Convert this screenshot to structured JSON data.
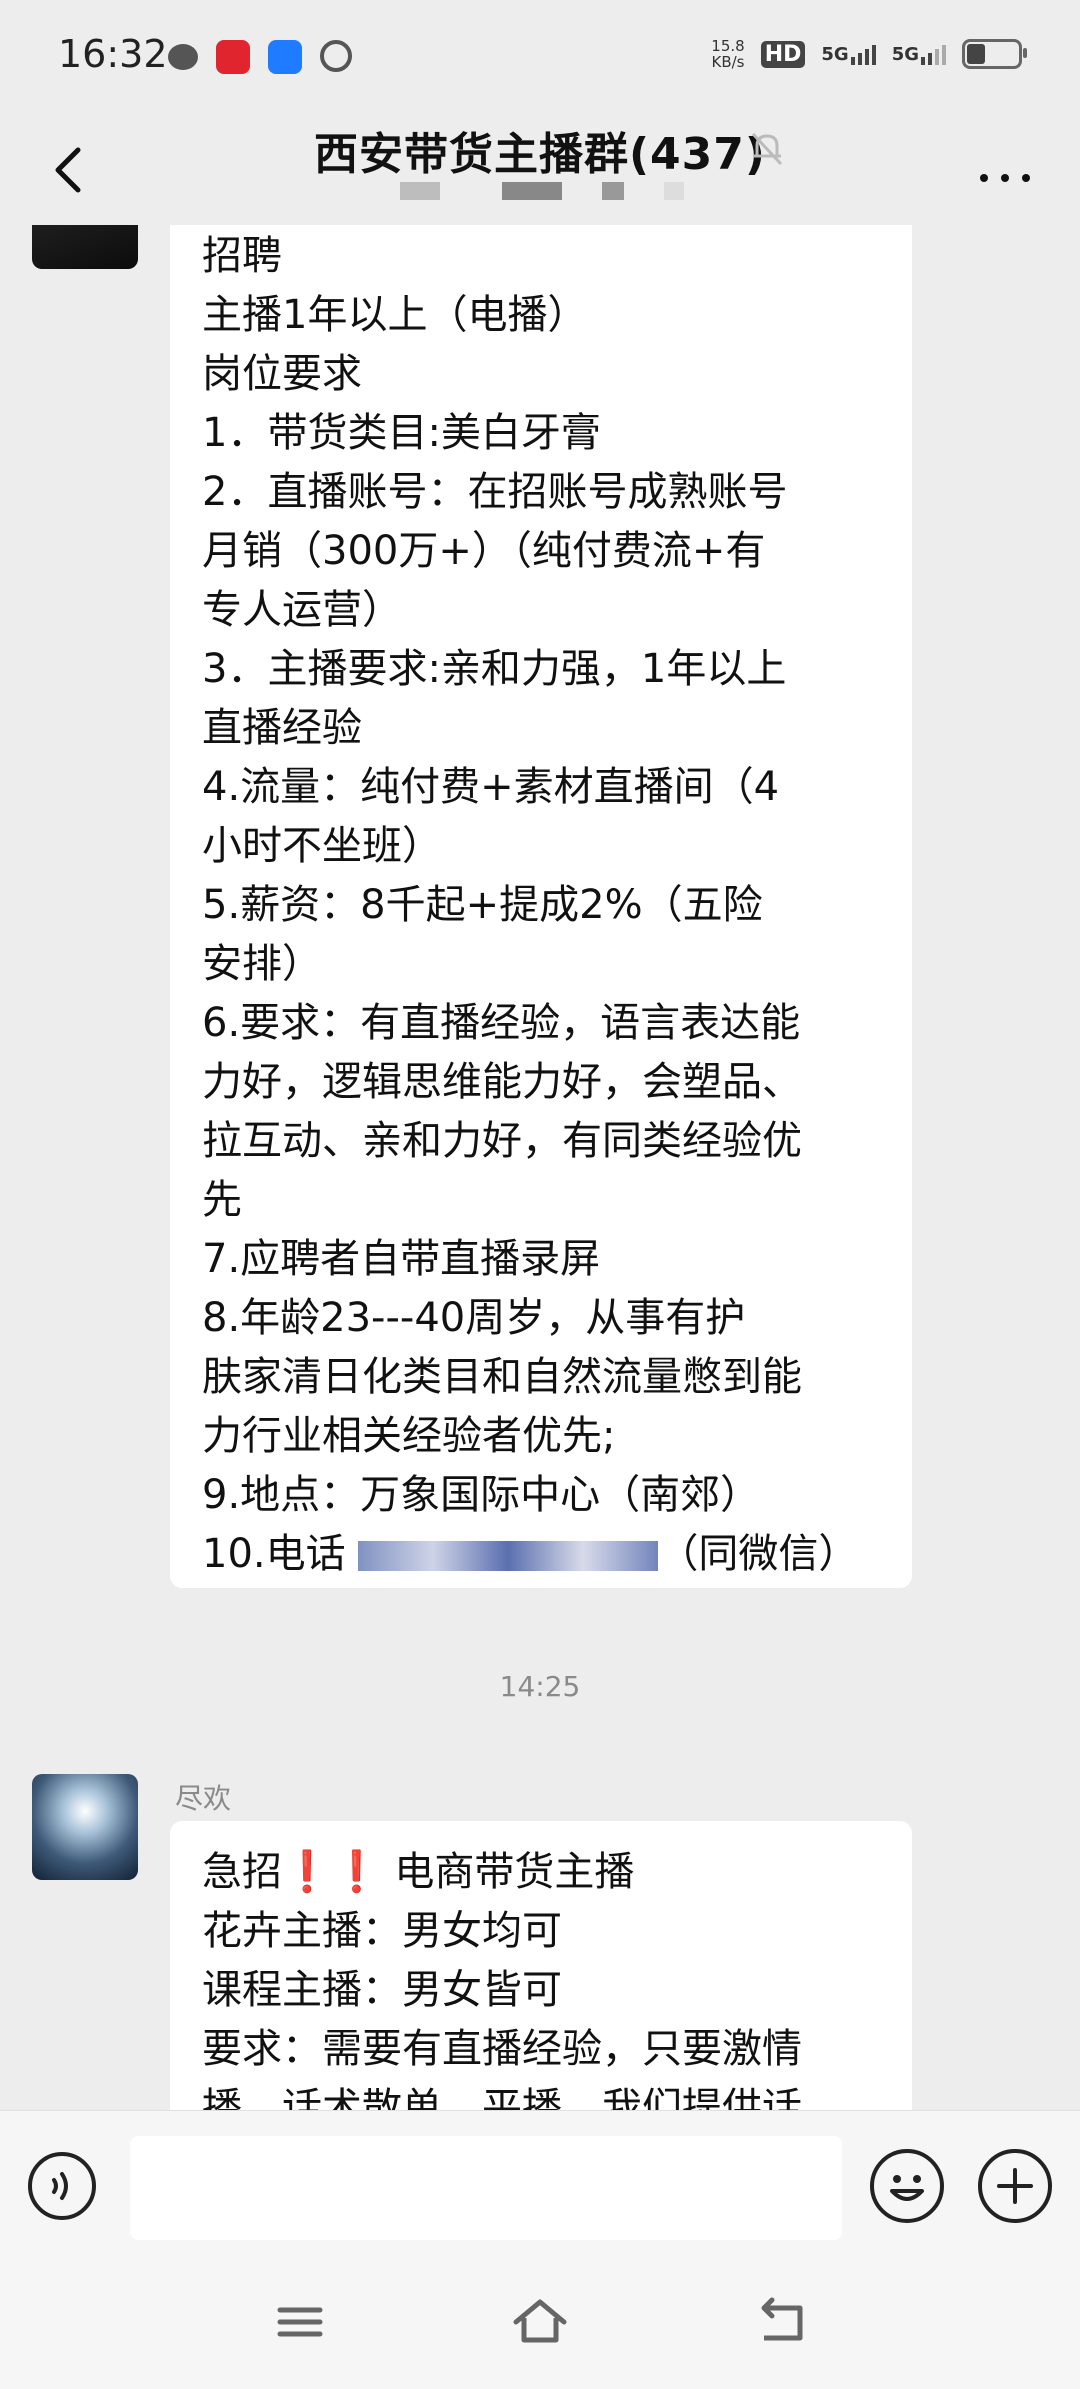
{
  "status_bar": {
    "time": "16:32",
    "net_speed_value": "15.8",
    "net_speed_unit": "KB/s",
    "hd_label": "HD",
    "signal_1": "5G",
    "signal_2": "5G"
  },
  "header": {
    "title": "西安带货主播群(437)"
  },
  "messages": [
    {
      "type": "text",
      "lines": [
        "招聘",
        "主播1年以上（电播）",
        "岗位要求",
        "1．带货类目:美白牙膏",
        "2．直播账号：在招账号成熟账号",
        "月销（300万+）（纯付费流+有",
        "专人运营）",
        "3．主播要求:亲和力强，1年以上",
        "直播经验",
        "4.流量：纯付费+素材直播间（4",
        "小时不坐班）",
        "5.薪资：8千起+提成2%（五险",
        "安排）",
        "6.要求：有直播经验，语言表达能",
        "力好，逻辑思维能力好，会塑品、",
        "拉互动、亲和力好，有同类经验优",
        "先",
        "7.应聘者自带直播录屏",
        "8.年龄23---40周岁，从事有护",
        "肤家清日化类目和自然流量憋到能",
        "力行业相关经验者优先;",
        "9.地点：万象国际中心（南郊）"
      ],
      "last_line_prefix": "10.电话",
      "last_line_suffix": "（同微信）"
    },
    {
      "type": "time",
      "text": "14:25"
    },
    {
      "type": "text",
      "sender": "尽欢",
      "lines": [
        "急招❗❗ 电商带货主播",
        "花卉主播：男女均可",
        "课程主播：男女皆可",
        "要求：需要有直播经验，只要激情",
        "播，话术散单，平播，我们提供话"
      ]
    }
  ],
  "icons": {
    "back": "chevron-left-icon",
    "mute": "bell-off-icon",
    "more": "more-dots-icon",
    "voice": "voice-icon",
    "emoji": "emoji-icon",
    "plus": "plus-icon",
    "nav_menu": "menu-icon",
    "nav_home": "home-icon",
    "nav_back": "back-icon"
  }
}
